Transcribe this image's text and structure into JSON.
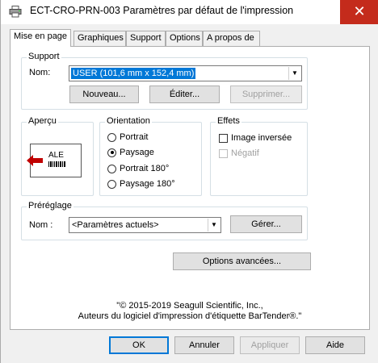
{
  "window": {
    "title": "ECT-CRO-PRN-003 Paramètres par défaut de l'impression",
    "close_label": "✕"
  },
  "tabs": [
    {
      "label": "Mise en page",
      "active": true
    },
    {
      "label": "Graphiques"
    },
    {
      "label": "Support"
    },
    {
      "label": "Options"
    },
    {
      "label": "A propos de"
    }
  ],
  "support": {
    "group_label": "Support",
    "name_label": "Nom:",
    "selected": "USER (101,6 mm x 152,4 mm)",
    "new_button": "Nouveau...",
    "edit_button": "Éditer...",
    "delete_button": "Supprimer..."
  },
  "preview": {
    "group_label": "Aperçu",
    "sample_text": "ALE"
  },
  "orientation": {
    "group_label": "Orientation",
    "options": [
      "Portrait",
      "Paysage",
      "Portrait 180°",
      "Paysage 180°"
    ],
    "selected": "Paysage"
  },
  "effects": {
    "group_label": "Effets",
    "inverted_label": "Image inversée",
    "negative_label": "Négatif"
  },
  "preset": {
    "group_label": "Préréglage",
    "name_label": "Nom :",
    "selected": "<Paramètres actuels>",
    "manage_button": "Gérer..."
  },
  "advanced_button": "Options avancées...",
  "copyright": {
    "line1": "\"© 2015-2019 Seagull Scientific, Inc.,",
    "line2": "Auteurs du logiciel d'impression d'étiquette BarTender®.\""
  },
  "footer": {
    "ok": "OK",
    "cancel": "Annuler",
    "apply": "Appliquer",
    "help": "Aide"
  },
  "colors": {
    "accent": "#0078d7",
    "close": "#c42b1c",
    "arrow_red": "#c00000"
  }
}
